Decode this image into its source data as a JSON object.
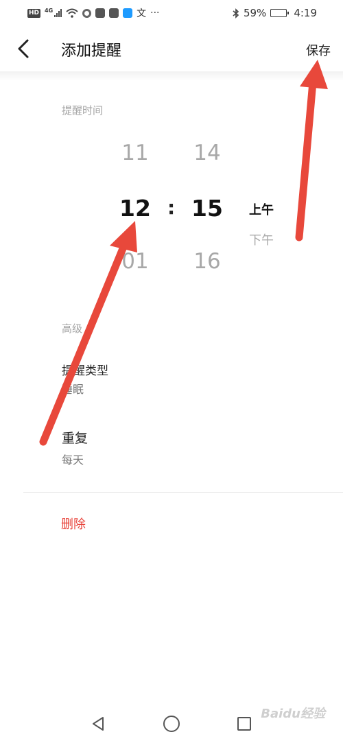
{
  "status_bar": {
    "hd_badge": "HD",
    "network": "4G",
    "text_icon": "文",
    "more": "···",
    "bluetooth_icon": "bluetooth-icon",
    "battery_percent": "59%",
    "battery_level": 0.59,
    "time": "4:19"
  },
  "header": {
    "back_icon": "chevron-left-icon",
    "title": "添加提醒",
    "save_label": "保存"
  },
  "time_section": {
    "label": "提醒时间",
    "hours": {
      "prev": "11",
      "selected": "12",
      "next": "01"
    },
    "separator": ":",
    "minutes": {
      "prev": "14",
      "selected": "15",
      "next": "16"
    },
    "period": {
      "selected": "上午",
      "other": "下午"
    }
  },
  "advanced_section": {
    "label": "高级",
    "reminder_type": {
      "title": "提醒类型",
      "value": "睡眠"
    },
    "repeat": {
      "title": "重复",
      "value": "每天"
    }
  },
  "delete_label": "删除",
  "watermark": "Baidu经验",
  "colors": {
    "accent_red": "#e8433a",
    "annotation_arrow": "#e8483b",
    "dim_text": "#a8a8a8"
  }
}
